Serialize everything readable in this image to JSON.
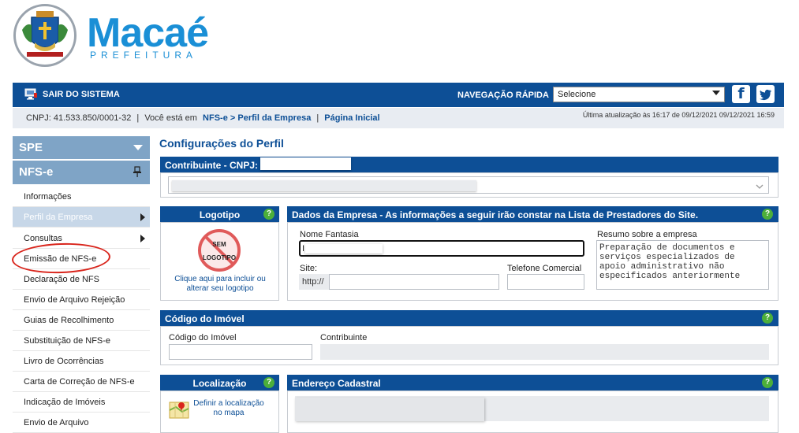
{
  "header": {
    "brand_name": "Macaé",
    "brand_subtitle": "PREFEITURA"
  },
  "topbar": {
    "logout_label": "SAIR DO SISTEMA",
    "quick_nav_label": "NAVEGAÇÃO RÁPIDA",
    "quick_nav_value": "Selecione",
    "facebook_glyph": "f",
    "twitter_glyph": "t"
  },
  "infobar": {
    "cnpj": "CNPJ: 41.533.850/0001-32",
    "sep1": "|",
    "you_are_in": "Você está em",
    "crumb_nfse": "NFS-e",
    "crumb_sep": ">",
    "crumb_profile": "Perfil da Empresa",
    "sep2": "|",
    "home_link": "Página Inicial",
    "last_update": "Última atualização às 16:17 de 09/12/2021  09/12/2021 16:59"
  },
  "sidebar": {
    "spe_label": "SPE",
    "nfse_label": "NFS-e",
    "items": [
      {
        "label": "Informações"
      },
      {
        "label": "Perfil da Empresa"
      },
      {
        "label": "Consultas"
      },
      {
        "label": "Emissão de NFS-e"
      },
      {
        "label": "Declaração de NFS"
      },
      {
        "label": "Envio de Arquivo Rejeição"
      },
      {
        "label": "Guias de Recolhimento"
      },
      {
        "label": "Substituição de NFS-e"
      },
      {
        "label": "Livro de Ocorrências"
      },
      {
        "label": "Carta de Correção de NFS-e"
      },
      {
        "label": "Indicação de Imóveis"
      },
      {
        "label": "Envio de Arquivo"
      }
    ]
  },
  "main": {
    "page_title": "Configurações do Perfil",
    "contribuinte_label": "Contribuinte - CNPJ:",
    "logotipo": {
      "title": "Logotipo",
      "no_logo_line1": "SEM",
      "no_logo_line2": "LOGOTIPO",
      "link": "Clique aqui para incluir ou alterar seu logotipo"
    },
    "dados": {
      "title": "Dados da Empresa - As informações a seguir irão constar na Lista de Prestadores do Site.",
      "nome_fantasia_label": "Nome Fantasia",
      "nome_fantasia_value": "I",
      "site_label": "Site:",
      "site_prefix": "http://",
      "telefone_label": "Telefone Comercial",
      "resumo_label": "Resumo sobre a empresa",
      "resumo_value": "Preparação de documentos e serviços especializados de apoio administrativo não especificados anteriormente"
    },
    "imovel": {
      "title": "Código do Imóvel",
      "codigo_label": "Código do Imóvel",
      "contribuinte_label": "Contribuinte"
    },
    "localizacao": {
      "title": "Localização",
      "link": "Definir a localização no mapa"
    },
    "endereco": {
      "title": "Endereço Cadastral"
    },
    "help_glyph": "?"
  },
  "colors": {
    "primary": "#0d4f96",
    "brand": "#1a8fd6",
    "help": "#4caf3a",
    "highlight_circle": "#d9251c"
  }
}
